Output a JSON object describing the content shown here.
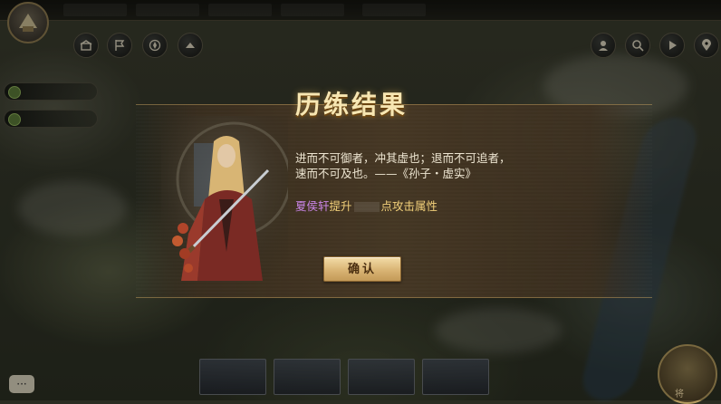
{
  "dialog": {
    "title": "历练结果",
    "quote_line1": "进而不可御者，冲其虚也；退而不可追者，",
    "quote_line2": "速而不可及也。——《孙子・虚实》",
    "hero_name": "夏侯轩",
    "reward_prefix": "提升",
    "reward_suffix": "点攻击属性",
    "confirm_label": "确认"
  },
  "colors": {
    "title": "#f7e6b2",
    "hero_name": "#c985e6",
    "reward_text": "#f2d07a",
    "button_gold": "#d9b474"
  },
  "toolbar_left_icons": [
    "city-icon",
    "flag-icon",
    "compass-icon",
    "up-arrow-icon"
  ],
  "toolbar_right_icons": [
    "avatar-icon",
    "search-icon",
    "play-icon",
    "map-pin-icon"
  ],
  "bottom_label": "将"
}
